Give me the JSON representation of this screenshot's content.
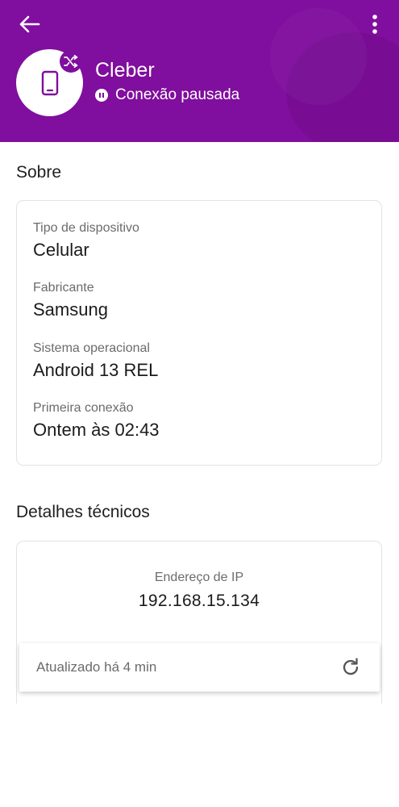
{
  "header": {
    "device_name": "Cleber",
    "status": "Conexão pausada",
    "background_color": "#800e9e",
    "icons": {
      "back": "arrow-left-icon",
      "more": "more-vert-icon",
      "avatar": "smartphone-icon",
      "badge": "shuffle-icon",
      "status": "pause-icon"
    }
  },
  "about": {
    "title": "Sobre",
    "fields": [
      {
        "label": "Tipo de dispositivo",
        "value": "Celular"
      },
      {
        "label": "Fabricante",
        "value": "Samsung"
      },
      {
        "label": "Sistema operacional",
        "value": "Android 13 REL"
      },
      {
        "label": "Primeira conexão",
        "value": "Ontem às 02:43"
      }
    ]
  },
  "technical": {
    "title": "Detalhes técnicos",
    "ip_label": "Endereço de IP",
    "ip_value": "192.168.15.134"
  },
  "update_bar": {
    "text": "Atualizado há 4 min",
    "icon": "refresh-icon"
  }
}
